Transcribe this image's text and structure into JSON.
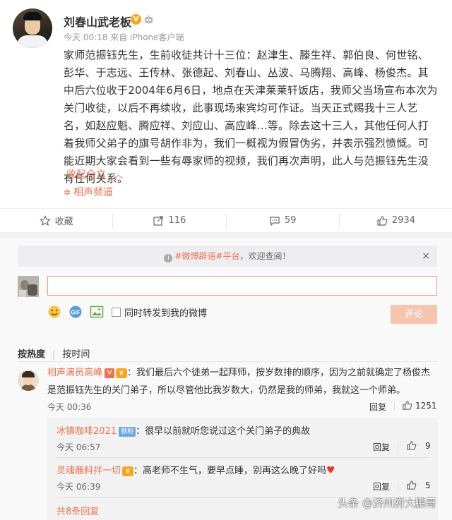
{
  "post": {
    "author": "刘春山武老板",
    "verified_badge": "V",
    "meta": "今天 00:18 来自 iPhone客户端",
    "content": "家师范振钰先生，生前收徒共计十三位：赵津生、滕生祥、郭伯良、何世铭、彭华、于志远、王传林、张德起、刘春山、丛波、马腾翔、高峰、杨俊杰。其中后六位收于2004年6月6日，地点在天津莱莱轩饭店，我师父当场宣布本次为关门收徒，以后不再续收，此事现场来宾均可作证。当天正式赐我十三人艺名，如赵应魁、腾应祥、刘应山、高应峰…等。除去这十三人，其他任何人打着我师父弟子的旗号胡作非为，我们一概视为假冒伪劣，并表示强烈愤慨。可能近期大家会看到一些有辱家师的视频，我们再次声明，此人与范振钰先生没有任何关系。",
    "collapse_label": "收起全文",
    "collapse_icon": "chevron-up-icon",
    "topic": "相声频道",
    "topic_icon": "star-icon"
  },
  "actions": {
    "favorite": "收藏",
    "repost": "116",
    "comment": "59",
    "like": "2934"
  },
  "notice": {
    "hashtag": "#微博辟谣#平台",
    "text": "，欢迎查阅！",
    "close": "×"
  },
  "composer": {
    "placeholder": "",
    "forward_label": "同时转发到我的微博",
    "submit_label": "评论"
  },
  "sort": {
    "hot": "按热度",
    "time": "按时间"
  },
  "comment": {
    "author": "相声演员高峰",
    "author_badge": "V",
    "text": "：我们最后六个徒弟一起拜师，按岁数排的顺序，因为之前就确定了杨俊杰是范振钰先生的关门弟子，所以尽管他比我岁数大，仍然是我的师弟，我就这一个师弟。",
    "time": "今天 00:36",
    "reply_label": "回复",
    "likes": "1251"
  },
  "replies": [
    {
      "author": "冰镇咖啡2021",
      "badge": "铁粉",
      "text": "：很早以前就听您说过这个关门弟子的典故",
      "time": "今天 06:57",
      "reply_label": "回复",
      "likes": "9"
    },
    {
      "author": "灵魂蘸料拌一切",
      "text": "：高老师不生气，要早点睡，别再这么晚了好吗",
      "time": "今天 06:39",
      "reply_label": "回复",
      "likes": "5"
    }
  ],
  "more_replies": "共8条回复",
  "watermark": "头条 @济州府大鹏哥",
  "colors": {
    "accent": "#eb7350",
    "submit_disabled": "#f7c4b0",
    "input_border": "#ee9c6d"
  }
}
